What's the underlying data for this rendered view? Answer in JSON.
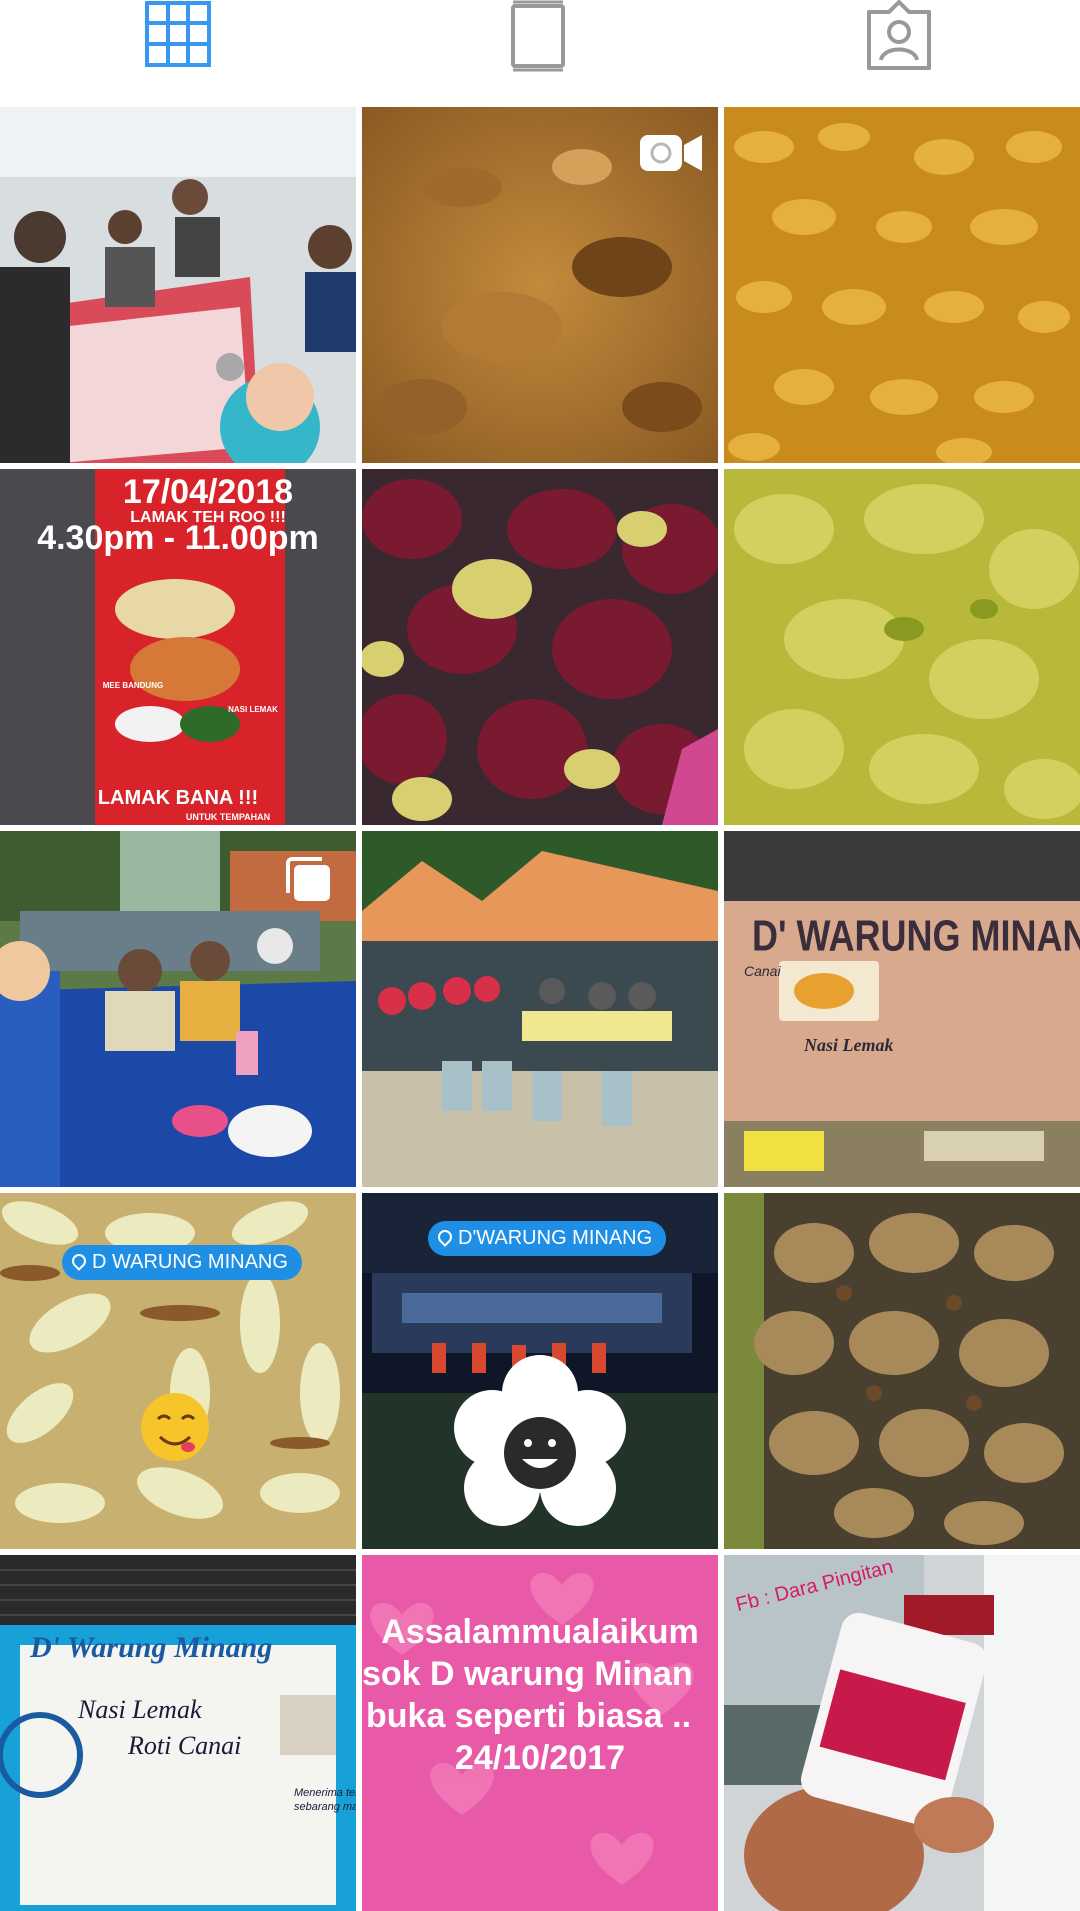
{
  "tabs": [
    {
      "name": "grid",
      "icon": "grid-icon",
      "active": true,
      "color": "#3897f0"
    },
    {
      "name": "feed",
      "icon": "feed-icon",
      "active": false,
      "color": "#999999"
    },
    {
      "name": "tagged",
      "icon": "tagged-person-icon",
      "active": false,
      "color": "#999999"
    }
  ],
  "posts": [
    {
      "kind": "photo",
      "subject": "group selfie at table"
    },
    {
      "kind": "video",
      "subject": "curry close-up",
      "badge_icon": "video-camera-icon"
    },
    {
      "kind": "photo",
      "subject": "yellow curry"
    },
    {
      "kind": "photo",
      "subject": "event poster",
      "date": "17/04/2018",
      "tagline": "LAMAK TEH ROO !!!",
      "hours": "4.30pm - 11.00pm",
      "slogan": "LAMAK BANA !!!",
      "label_1": "MEE BANDUNG",
      "label_2": "NASI LEMAK",
      "footer": "UNTUK TEMPAHAN"
    },
    {
      "kind": "photo",
      "subject": "jering beans"
    },
    {
      "kind": "photo",
      "subject": "green curry"
    },
    {
      "kind": "carousel",
      "subject": "diners at blue table",
      "badge_icon": "carousel-icon"
    },
    {
      "kind": "photo",
      "subject": "tents and tables"
    },
    {
      "kind": "photo",
      "subject": "shop signboard",
      "sign_title": "D' WARUNG MINANG",
      "sign_sub": "Nasi Lemak",
      "sign_sub2": "Canai"
    },
    {
      "kind": "photo",
      "subject": "fruit slices",
      "location": "D WARUNG MINANG"
    },
    {
      "kind": "photo",
      "subject": "stall at night",
      "location": "D'WARUNG MINANG"
    },
    {
      "kind": "photo",
      "subject": "fried chicken"
    },
    {
      "kind": "photo",
      "subject": "blue signboard",
      "sign_title": "D' Warung Minang",
      "line_1": "Nasi Lemak",
      "line_2": "Roti Canai",
      "small_1": "Menerima tem",
      "small_2": "sebarang maj"
    },
    {
      "kind": "photo",
      "subject": "pink greeting",
      "line_1": "Assalammualaikum",
      "line_2": "sok D warung Minan",
      "line_3": "buka seperti biasa ..",
      "line_4": "24/10/2017"
    },
    {
      "kind": "photo",
      "subject": "product jar",
      "watermark": "Fb : Dara Pingitan"
    }
  ]
}
